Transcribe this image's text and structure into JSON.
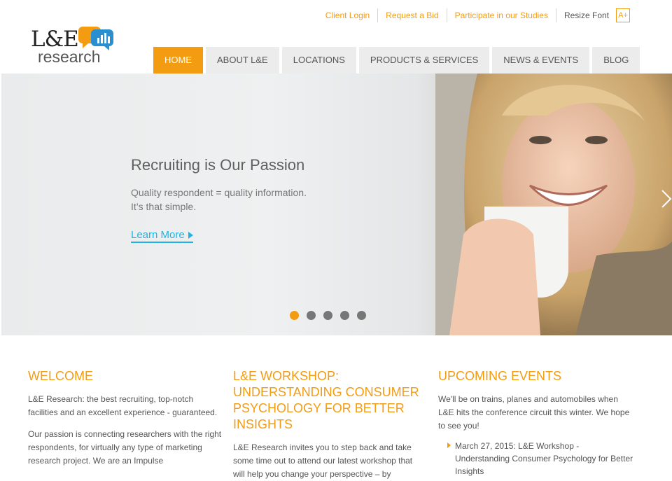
{
  "utility": {
    "client_login": "Client Login",
    "request_bid": "Request a Bid",
    "participate": "Participate in our Studies",
    "resize_label": "Resize Font",
    "resize_button": "A+"
  },
  "logo": {
    "top": "L&E",
    "bottom": "research"
  },
  "nav": {
    "items": [
      {
        "label": "HOME"
      },
      {
        "label": "ABOUT L&E"
      },
      {
        "label": "LOCATIONS"
      },
      {
        "label": "PRODUCTS & SERVICES"
      },
      {
        "label": "NEWS & EVENTS"
      },
      {
        "label": "BLOG"
      }
    ],
    "active_index": 0
  },
  "hero": {
    "title": "Recruiting is Our Passion",
    "subtitle_line1": "Quality respondent = quality information.",
    "subtitle_line2": "It’s that simple.",
    "cta": "Learn More",
    "slide_count": 5,
    "active_slide": 1
  },
  "welcome": {
    "heading": "WELCOME",
    "p1": "L&E Research: the best recruiting, top-notch facilities and an excellent experience - guaranteed.",
    "p2": "Our passion is connecting researchers with the right respondents, for virtually any type of marketing research project. We are an Impulse"
  },
  "workshop": {
    "heading": "L&E WORKSHOP: UNDERSTANDING CONSUMER PSYCHOLOGY FOR BETTER INSIGHTS",
    "p1": "L&E Research invites you to step back and take some time out to attend our latest workshop that will help you change your perspective – by"
  },
  "events": {
    "heading": "UPCOMING EVENTS",
    "intro": "We'll be on trains, planes and automobiles when L&E hits the conference circuit this winter. We hope to see you!",
    "items": [
      {
        "text": "March 27, 2015: L&E Workshop - Understanding Consumer Psychology for Better Insights"
      }
    ]
  },
  "colors": {
    "accent": "#f39c12",
    "link_blue": "#1fb4e3",
    "nav_bg": "#ececec"
  }
}
